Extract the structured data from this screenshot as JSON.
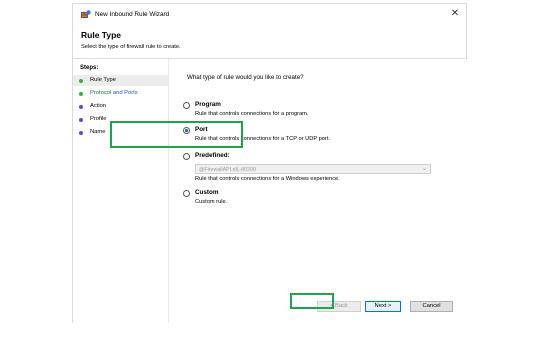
{
  "window": {
    "title": "New Inbound Rule Wizard",
    "close_glyph": "✕"
  },
  "header": {
    "title": "Rule Type",
    "subtitle": "Select the type of firewall rule to create."
  },
  "sidebar": {
    "steps_label": "Steps:",
    "items": [
      {
        "label": "Rule Type",
        "state": "current",
        "dot_color": "#3cb043"
      },
      {
        "label": "Protocol and Ports",
        "state": "link",
        "dot_color": "#3cb043"
      },
      {
        "label": "Action",
        "state": "pending",
        "dot_color": "#5b4fc4"
      },
      {
        "label": "Profile",
        "state": "pending",
        "dot_color": "#5b4fc4"
      },
      {
        "label": "Name",
        "state": "pending",
        "dot_color": "#5b4fc4"
      }
    ]
  },
  "main": {
    "question": "What type of rule would you like to create?",
    "options": [
      {
        "title": "Program",
        "description": "Rule that controls connections for a program.",
        "selected": false
      },
      {
        "title": "Port",
        "description": "Rule that controls connections for a TCP or UDP port.",
        "selected": true
      },
      {
        "title": "Predefined:",
        "description": "Rule that controls connections for a Windows experience.",
        "selected": false,
        "select_value": "@FirewallAPI.dll,-80200"
      },
      {
        "title": "Custom",
        "description": "Custom rule.",
        "selected": false
      }
    ]
  },
  "buttons": {
    "back": "< Back",
    "next": "Next >",
    "cancel": "Cancel"
  },
  "colors": {
    "highlight": "#1aa54a",
    "link": "#1a5bb5",
    "accent": "#0078d7"
  },
  "icons": {
    "app": "firewall-wizard-icon",
    "close": "close-icon",
    "dropdown": "chevron-down-icon"
  }
}
